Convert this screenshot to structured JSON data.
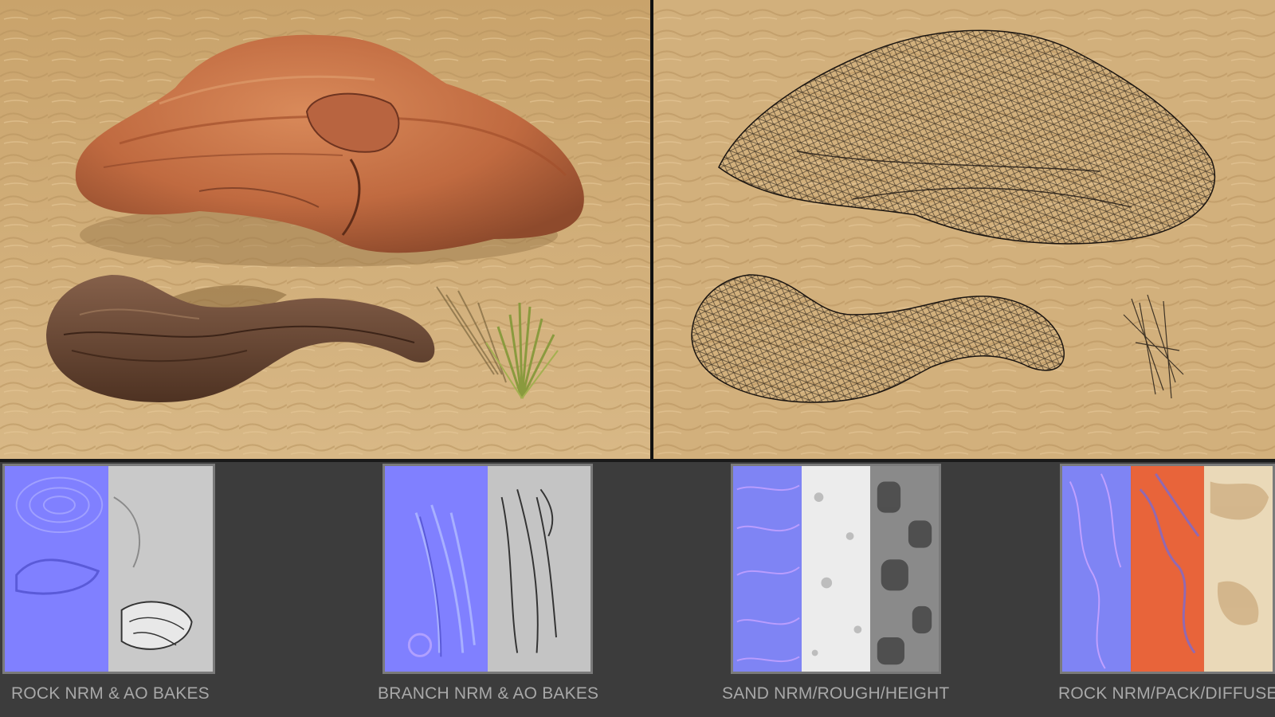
{
  "viewports": {
    "left": {
      "mode": "lit-render",
      "subject": [
        "rock",
        "branch",
        "grass"
      ]
    },
    "right": {
      "mode": "wireframe",
      "subject": [
        "rock",
        "branch",
        "grass"
      ]
    }
  },
  "colors": {
    "sand": "#d2b07c",
    "rock": "#c06a40",
    "branch": "#6e4a34",
    "grass": "#8a9a3e",
    "wire": "#1a1410",
    "normal_map": "#8080ff",
    "panel_bg": "#3c3c3c",
    "caption": "#a8a8a8"
  },
  "texture_panels": [
    {
      "caption": "ROCK NRM & AO BAKES",
      "maps": [
        "normal",
        "ambient-occlusion"
      ]
    },
    {
      "caption": "BRANCH NRM & AO BAKES",
      "maps": [
        "normal",
        "ambient-occlusion"
      ]
    },
    {
      "caption": "SAND NRM/ROUGH/HEIGHT",
      "maps": [
        "normal",
        "roughness",
        "height"
      ]
    },
    {
      "caption": "ROCK NRM/PACK/DIFFUSE",
      "maps": [
        "normal",
        "packed",
        "diffuse"
      ]
    }
  ]
}
